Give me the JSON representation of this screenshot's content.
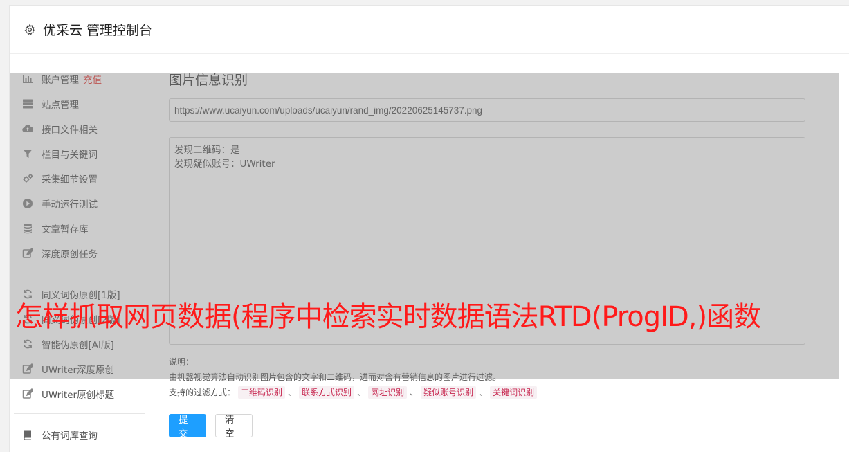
{
  "header": {
    "title": "优采云 管理控制台",
    "icon": "gear-icon"
  },
  "sidebar": {
    "items": [
      {
        "label": "账户管理",
        "badge": "充值",
        "icon": "bar-chart-icon"
      },
      {
        "label": "站点管理",
        "icon": "server-icon"
      },
      {
        "label": "接口文件相关",
        "icon": "cloud-upload-icon"
      },
      {
        "label": "栏目与关键词",
        "icon": "filter-icon"
      },
      {
        "label": "采集细节设置",
        "icon": "cogs-icon"
      },
      {
        "label": "手动运行测试",
        "icon": "play-circle-icon"
      },
      {
        "label": "文章暂存库",
        "icon": "database-icon"
      },
      {
        "label": "深度原创任务",
        "icon": "edit-icon"
      },
      {
        "label": "同义词伪原创[1版]",
        "icon": "refresh-icon"
      },
      {
        "label": "同义词伪原创[2版]",
        "icon": "refresh-icon"
      },
      {
        "label": "智能伪原创[AI版]",
        "icon": "refresh-icon"
      },
      {
        "label": "UWriter深度原创",
        "icon": "edit-icon"
      },
      {
        "label": "UWriter原创标题",
        "icon": "edit-icon"
      },
      {
        "label": "公有词库查询",
        "icon": "book-icon"
      }
    ]
  },
  "main": {
    "heading": "图片信息识别",
    "url_value": "https://www.ucaiyun.com/uploads/ucaiyun/rand_img/20220625145737.png",
    "result_lines": [
      "发现二维码：是",
      "发现疑似账号：UWriter"
    ],
    "note_title": "说明：",
    "note_desc": "由机器视觉算法自动识别图片包含的文字和二维码，进而对含有营销信息的图片进行过滤。",
    "filter_label": "支持的过滤方式：",
    "filters": [
      "二维码识别",
      "联系方式识别",
      "网址识别",
      "疑似账号识别",
      "关键词识别"
    ],
    "separator": "、",
    "submit_label": "提交",
    "clear_label": "清空"
  },
  "banner": "怎样抓取网页数据(程序中检索实时数据语法RTD(ProgID,)函数",
  "colors": {
    "accent": "#1e9fff",
    "banner": "#ff1a1a",
    "badge": "#e53935"
  }
}
